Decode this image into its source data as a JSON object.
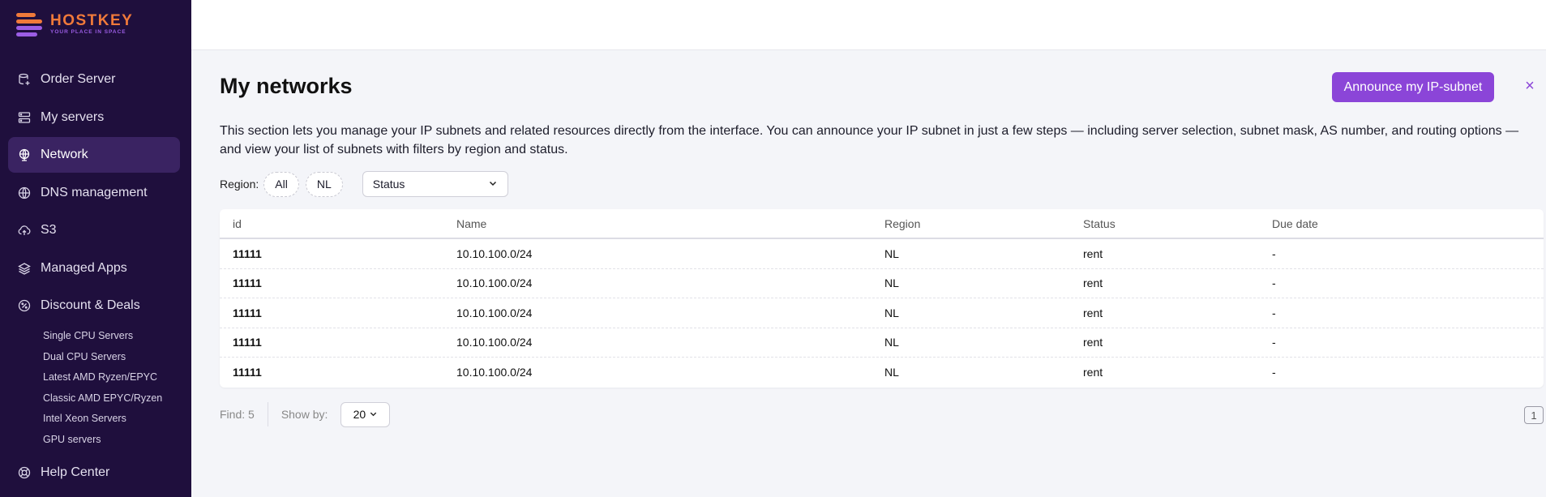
{
  "brand": {
    "name": "HOSTKEY",
    "tagline": "YOUR PLACE IN SPACE"
  },
  "sidebar": {
    "items": [
      {
        "label": "Order Server",
        "icon": "server-add-icon"
      },
      {
        "label": "My servers",
        "icon": "servers-icon"
      },
      {
        "label": "Network",
        "icon": "globe-icon",
        "active": true
      },
      {
        "label": "DNS management",
        "icon": "dns-globe-icon"
      },
      {
        "label": "S3",
        "icon": "cloud-upload-icon"
      },
      {
        "label": "Managed Apps",
        "icon": "layers-icon"
      },
      {
        "label": "Discount & Deals",
        "icon": "discount-icon"
      }
    ],
    "sub_items": [
      "Single CPU Servers",
      "Dual CPU Servers",
      "Latest AMD Ryzen/EPYC",
      "Classic AMD EPYC/Ryzen",
      "Intel Xeon Servers",
      "GPU servers"
    ],
    "help": {
      "label": "Help Center",
      "icon": "lifebuoy-icon"
    }
  },
  "page": {
    "title": "My networks",
    "announce_label": "Announce my IP-subnet",
    "close_symbol": "×",
    "description": "This section lets you manage your IP subnets and related resources directly from the interface. You can announce your IP subnet in just a few steps — including server selection, subnet mask, AS number, and routing options — and view your list of subnets with filters by region and status."
  },
  "filters": {
    "region_label": "Region:",
    "region_chips": [
      "All",
      "NL"
    ],
    "status_value": "Status"
  },
  "table": {
    "columns": [
      "id",
      "Name",
      "Region",
      "Status",
      "Due date"
    ],
    "rows": [
      {
        "id": "11111",
        "name": "10.10.100.0/24",
        "region": "NL",
        "status": "rent",
        "due": "-"
      },
      {
        "id": "11111",
        "name": "10.10.100.0/24",
        "region": "NL",
        "status": "rent",
        "due": "-"
      },
      {
        "id": "11111",
        "name": "10.10.100.0/24",
        "region": "NL",
        "status": "rent",
        "due": "-"
      },
      {
        "id": "11111",
        "name": "10.10.100.0/24",
        "region": "NL",
        "status": "rent",
        "due": "-"
      },
      {
        "id": "11111",
        "name": "10.10.100.0/24",
        "region": "NL",
        "status": "rent",
        "due": "-"
      }
    ]
  },
  "footer": {
    "find_text": "Find: 5",
    "show_by_label": "Show by:",
    "show_by_value": "20",
    "page_number": "1"
  },
  "colors": {
    "sidebar_bg": "#1f0f3d",
    "accent": "#8b45d8",
    "brand_orange": "#f07a3a"
  }
}
